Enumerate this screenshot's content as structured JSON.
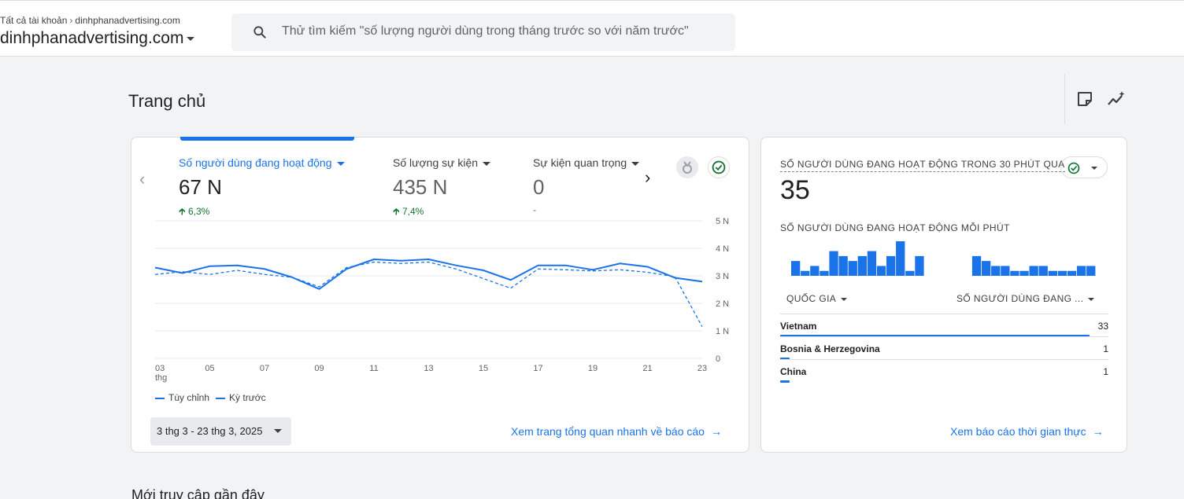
{
  "header": {
    "breadcrumb_root": "Tất cả tài khoản",
    "breadcrumb_leaf": "dinhphanadvertising.com",
    "account": "dinhphanadvertising.com",
    "search_placeholder": "Thử tìm kiếm \"số lượng người dùng trong tháng trước so với năm trước\""
  },
  "page": {
    "title": "Trang chủ",
    "tool_icons": [
      "insights-note-icon",
      "trend-sparkle-icon"
    ]
  },
  "metrics": [
    {
      "label": "Số người dùng đang hoạt động",
      "value": "67 N",
      "change": "6,3%",
      "active": true
    },
    {
      "label": "Số lượng sự kiện",
      "value": "435 N",
      "change": "7,4%",
      "active": false
    },
    {
      "label": "Sự kiện quan trọng",
      "value": "0",
      "change": "-",
      "active": false
    }
  ],
  "legend": {
    "current": "Tùy chỉnh",
    "previous": "Kỳ trước"
  },
  "date_range": "3 thg 3 - 23 thg 3, 2025",
  "overview_link": "Xem trang tổng quan nhanh về báo cáo",
  "chart_data": {
    "type": "line",
    "x": [
      "03",
      "04",
      "05",
      "06",
      "07",
      "08",
      "09",
      "10",
      "11",
      "12",
      "13",
      "14",
      "15",
      "16",
      "17",
      "18",
      "19",
      "20",
      "21",
      "22",
      "23"
    ],
    "x_tick_labels": [
      "03",
      "05",
      "07",
      "09",
      "11",
      "13",
      "15",
      "17",
      "19",
      "21",
      "23"
    ],
    "x_tick_sublabel": "thg",
    "y_tick_labels": [
      "0",
      "1 N",
      "2 N",
      "3 N",
      "4 N",
      "5 N"
    ],
    "ylim": [
      0,
      5000
    ],
    "grid": true,
    "legend_position": "bottom-left",
    "series": [
      {
        "name": "Tùy chỉnh",
        "style": "solid",
        "color": "#1a73e8",
        "values": [
          3300,
          3100,
          3350,
          3380,
          3250,
          2950,
          2520,
          3250,
          3600,
          3550,
          3600,
          3380,
          3200,
          2850,
          3380,
          3380,
          3220,
          3450,
          3330,
          2930,
          2790
        ]
      },
      {
        "name": "Kỳ trước",
        "style": "dashed",
        "color": "#1a73e8",
        "values": [
          3050,
          3150,
          3050,
          3200,
          3050,
          2950,
          2600,
          3300,
          3500,
          3450,
          3500,
          3250,
          2900,
          2550,
          3250,
          3220,
          3180,
          3220,
          3130,
          2970,
          1150
        ]
      }
    ]
  },
  "realtime": {
    "title": "SỐ NGƯỜI DÙNG ĐANG HOẠT ĐỘNG TRONG 30 PHÚT QUA",
    "value": "35",
    "per_minute_label": "SỐ NGƯỜI DÙNG ĐANG HOẠT ĐỘNG MỖI PHÚT",
    "per_minute_bars": [
      3,
      1,
      2,
      1,
      5,
      4,
      3,
      4,
      5,
      2,
      4,
      7,
      1,
      4,
      0,
      0,
      0,
      0,
      0,
      4,
      3,
      2,
      2,
      1,
      1,
      2,
      2,
      1,
      1,
      1,
      2,
      2
    ],
    "col_country": "QUỐC GIA",
    "col_users": "SỐ NGƯỜI DÙNG ĐANG ...",
    "rows": [
      {
        "country": "Vietnam",
        "users": 33
      },
      {
        "country": "Bosnia & Herzegovina",
        "users": 1
      },
      {
        "country": "China",
        "users": 1
      }
    ],
    "link": "Xem báo cáo thời gian thực"
  },
  "recent_title": "Mới truy cập gần đây",
  "colors": {
    "accent": "#1a73e8",
    "positive": "#137333",
    "background": "#f1f3f4"
  }
}
